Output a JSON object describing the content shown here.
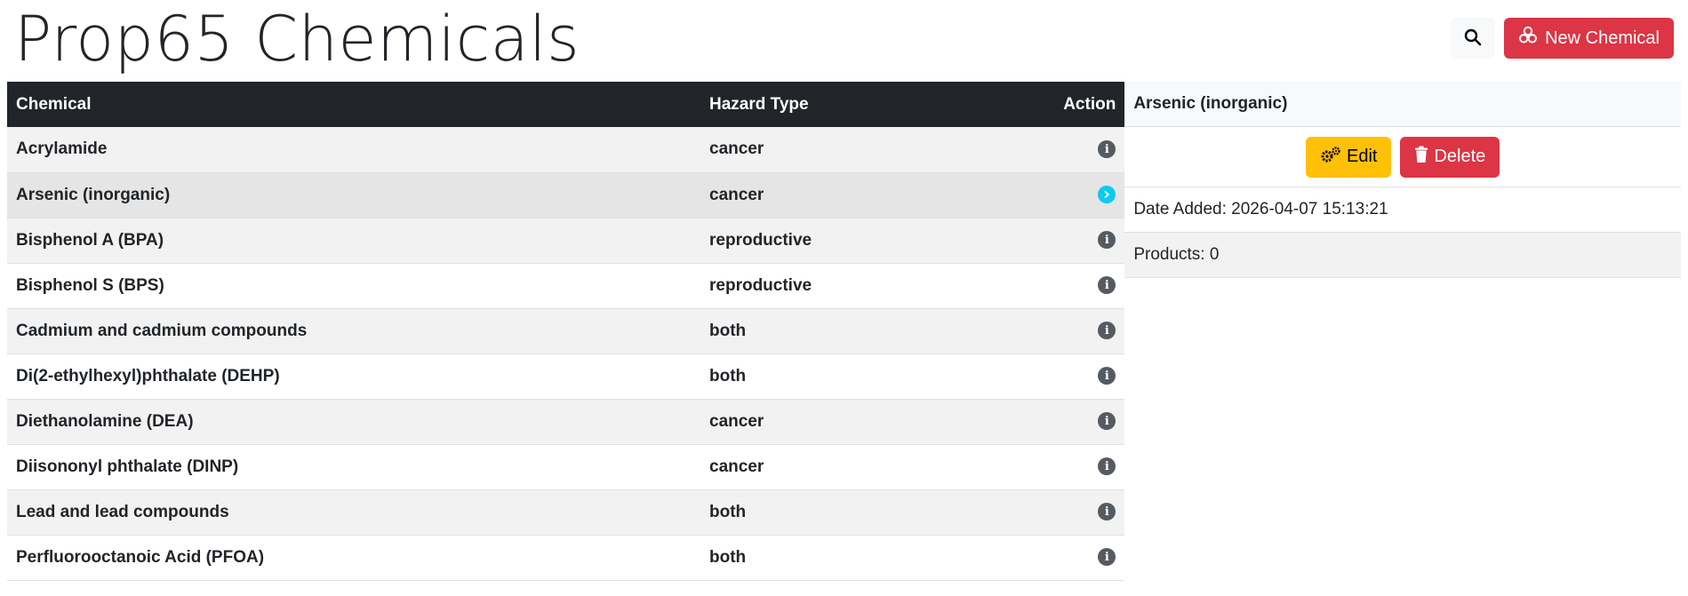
{
  "header": {
    "title": "Prop65 Chemicals",
    "search_icon": "search-icon",
    "new_button_label": "New Chemical",
    "new_button_icon": "biohazard-icon",
    "new_button_color": "#dc3545"
  },
  "table": {
    "columns": {
      "chemical": "Chemical",
      "hazard": "Hazard Type",
      "action": "Action"
    },
    "rows": [
      {
        "chemical": "Acrylamide",
        "hazard": "cancer",
        "icon": "info-icon"
      },
      {
        "chemical": "Arsenic (inorganic)",
        "hazard": "cancer",
        "icon": "chevron-right-icon",
        "selected": true
      },
      {
        "chemical": "Bisphenol A (BPA)",
        "hazard": "reproductive",
        "icon": "info-icon"
      },
      {
        "chemical": "Bisphenol S (BPS)",
        "hazard": "reproductive",
        "icon": "info-icon"
      },
      {
        "chemical": "Cadmium and cadmium compounds",
        "hazard": "both",
        "icon": "info-icon"
      },
      {
        "chemical": "Di(2-ethylhexyl)phthalate (DEHP)",
        "hazard": "both",
        "icon": "info-icon"
      },
      {
        "chemical": "Diethanolamine (DEA)",
        "hazard": "cancer",
        "icon": "info-icon"
      },
      {
        "chemical": "Diisononyl phthalate (DINP)",
        "hazard": "cancer",
        "icon": "info-icon"
      },
      {
        "chemical": "Lead and lead compounds",
        "hazard": "both",
        "icon": "info-icon"
      },
      {
        "chemical": "Perfluorooctanoic Acid (PFOA)",
        "hazard": "both",
        "icon": "info-icon"
      }
    ]
  },
  "detail": {
    "title": "Arsenic (inorganic)",
    "edit_label": "Edit",
    "edit_icon": "gears-icon",
    "delete_label": "Delete",
    "delete_icon": "trash-icon",
    "date_added": "Date Added: 2026-04-07 15:13:21",
    "products": "Products: 0"
  },
  "colors": {
    "header_bg": "#212529",
    "accent_info": "#0dcaf0",
    "warning": "#ffc107",
    "danger": "#dc3545"
  }
}
